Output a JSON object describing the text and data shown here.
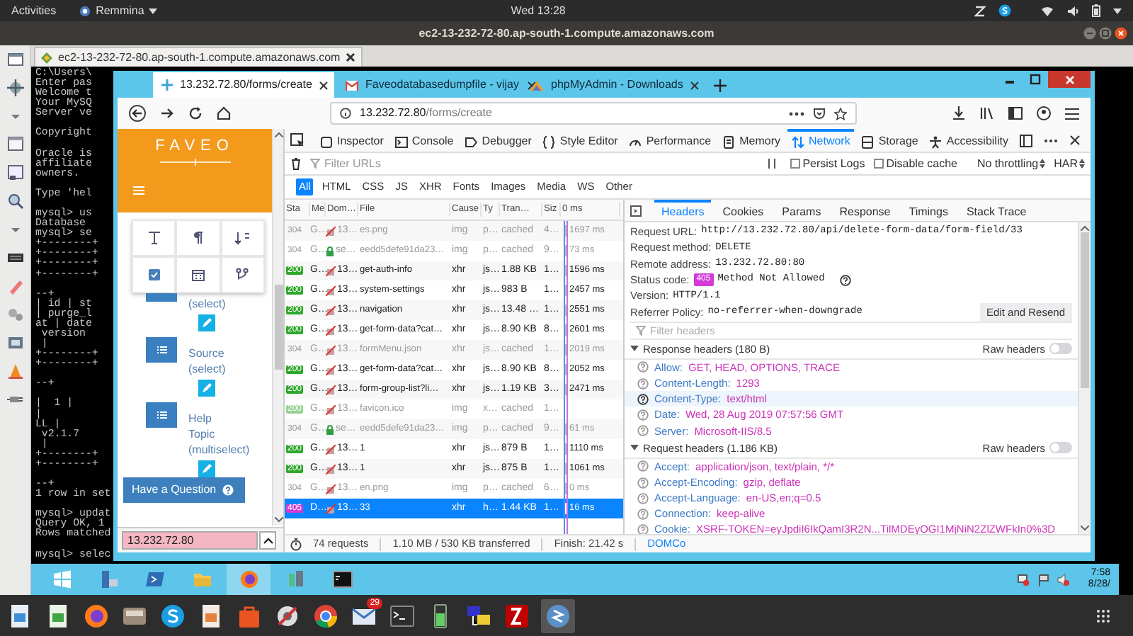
{
  "top_bar": {
    "activities": "Activities",
    "app_menu": "Remmina",
    "clock": "Wed 13:28"
  },
  "remmina": {
    "title": "ec2-13-232-72-80.ap-south-1.compute.amazonaws.com",
    "tab": "ec2-13-232-72-80.ap-south-1.compute.amazonaws.com"
  },
  "terminal": {
    "blocks": [
      [
        "C:\\Users\\",
        "Enter pas",
        "Welcome t",
        "Your MySQ",
        "Server ve"
      ],
      [
        "Copyright"
      ],
      [
        "Oracle is",
        "affiliate",
        "owners."
      ],
      [
        "Type 'hel"
      ],
      [
        "mysql> us",
        "Database",
        "mysql> se",
        "+--------+",
        "+--------+",
        "+--------+",
        "+--------+"
      ],
      [
        "--+",
        "| id | st",
        "| purge_l",
        "at | date",
        " version",
        " |",
        "+--------+",
        "+--------+"
      ],
      [
        "--+"
      ],
      [
        "|  1 |",
        "|",
        "LL |",
        " v2.1.7",
        " |",
        "+--------+",
        "+--------+"
      ],
      [
        "--+",
        "1 row in set"
      ],
      [
        "mysql> updat",
        "Query OK, 1",
        "Rows matched"
      ],
      [
        "mysql> selec"
      ]
    ]
  },
  "firefox": {
    "tabs": [
      {
        "label": "13.232.72.80/forms/create",
        "selected": true
      },
      {
        "label": "Faveodatabasedumpfile - vijay",
        "selected": false
      },
      {
        "label": "phpMyAdmin - Downloads",
        "selected": false
      }
    ],
    "url": {
      "host": "13.232.72.80",
      "path": "/forms/create"
    }
  },
  "page": {
    "logo": "FAVEO",
    "fields": [
      {
        "lines": [
          "(select)"
        ]
      },
      {
        "lines": [
          "Source",
          "(select)"
        ]
      },
      {
        "lines": [
          "Help",
          "Topic",
          "(multiselect)"
        ]
      }
    ],
    "help_button": "Have a Question",
    "find_value": "13.232.72.80"
  },
  "devtools": {
    "tools": [
      {
        "label": "Inspector",
        "selected": false
      },
      {
        "label": "Console",
        "selected": false
      },
      {
        "label": "Debugger",
        "selected": false
      },
      {
        "label": "Style Editor",
        "selected": false
      },
      {
        "label": "Performance",
        "selected": false
      },
      {
        "label": "Memory",
        "selected": false
      },
      {
        "label": "Network",
        "selected": true
      },
      {
        "label": "Storage",
        "selected": false
      },
      {
        "label": "Accessibility",
        "selected": false
      }
    ],
    "filter_placeholder": "Filter URLs",
    "options": [
      {
        "label": "Persist Logs",
        "checked": false
      },
      {
        "label": "Disable cache",
        "checked": false
      }
    ],
    "throttling": "No throttling",
    "har": "HAR",
    "types": [
      {
        "label": "All",
        "selected": true
      },
      {
        "label": "HTML",
        "selected": false
      },
      {
        "label": "CSS",
        "selected": false
      },
      {
        "label": "JS",
        "selected": false
      },
      {
        "label": "XHR",
        "selected": false
      },
      {
        "label": "Fonts",
        "selected": false
      },
      {
        "label": "Images",
        "selected": false
      },
      {
        "label": "Media",
        "selected": false
      },
      {
        "label": "WS",
        "selected": false
      },
      {
        "label": "Other",
        "selected": false
      }
    ],
    "columns": [
      "Sta",
      "Me",
      "Dom…",
      "File",
      "Cause",
      "Ty",
      "Tran…",
      "Siz",
      "0 ms"
    ],
    "rows": [
      {
        "status": "304",
        "kind": "cached",
        "method": "G…",
        "secure": false,
        "domain": "13…",
        "file": "es.png",
        "cause": "img",
        "type": "p…",
        "transferred": "cached",
        "size": "4…",
        "time": "1697 ms",
        "muted": true,
        "selected": false
      },
      {
        "status": "304",
        "kind": "cached",
        "method": "G…",
        "secure": true,
        "domain": "se…",
        "file": "eedd5defe91da23…",
        "cause": "img",
        "type": "p…",
        "transferred": "cached",
        "size": "9…",
        "time": "73 ms",
        "muted": true,
        "selected": false
      },
      {
        "status": "200",
        "kind": "ok",
        "method": "G…",
        "secure": false,
        "domain": "13…",
        "file": "get-auth-info",
        "cause": "xhr",
        "type": "js…",
        "transferred": "1.88 KB",
        "size": "1…",
        "time": "1596 ms",
        "muted": false,
        "selected": false
      },
      {
        "status": "200",
        "kind": "ok",
        "method": "G…",
        "secure": false,
        "domain": "13…",
        "file": "system-settings",
        "cause": "xhr",
        "type": "js…",
        "transferred": "983 B",
        "size": "1…",
        "time": "2457 ms",
        "muted": false,
        "selected": false
      },
      {
        "status": "200",
        "kind": "ok",
        "method": "G…",
        "secure": false,
        "domain": "13…",
        "file": "navigation",
        "cause": "xhr",
        "type": "js…",
        "transferred": "13.48 …",
        "size": "1…",
        "time": "2551 ms",
        "muted": false,
        "selected": false
      },
      {
        "status": "200",
        "kind": "ok",
        "method": "G…",
        "secure": false,
        "domain": "13…",
        "file": "get-form-data?cat…",
        "cause": "xhr",
        "type": "js…",
        "transferred": "8.90 KB",
        "size": "8…",
        "time": "2601 ms",
        "muted": false,
        "selected": false
      },
      {
        "status": "304",
        "kind": "cached",
        "method": "G…",
        "secure": false,
        "domain": "13…",
        "file": "formMenu.json",
        "cause": "xhr",
        "type": "js…",
        "transferred": "cached",
        "size": "1…",
        "time": "2019 ms",
        "muted": true,
        "selected": false
      },
      {
        "status": "200",
        "kind": "ok",
        "method": "G…",
        "secure": false,
        "domain": "13…",
        "file": "get-form-data?cat…",
        "cause": "xhr",
        "type": "js…",
        "transferred": "8.90 KB",
        "size": "8…",
        "time": "2052 ms",
        "muted": false,
        "selected": false
      },
      {
        "status": "200",
        "kind": "ok",
        "method": "G…",
        "secure": false,
        "domain": "13…",
        "file": "form-group-list?li…",
        "cause": "xhr",
        "type": "js…",
        "transferred": "1.19 KB",
        "size": "3…",
        "time": "2471 ms",
        "muted": false,
        "selected": false
      },
      {
        "status": "200",
        "kind": "ok",
        "method": "G…",
        "secure": false,
        "domain": "13…",
        "file": "favicon.ico",
        "cause": "img",
        "type": "x…",
        "transferred": "cached",
        "size": "1…",
        "muted": true,
        "selected": false
      },
      {
        "status": "304",
        "kind": "cached",
        "method": "G…",
        "secure": true,
        "domain": "se…",
        "file": "eedd5defe91da23…",
        "cause": "img",
        "type": "p…",
        "transferred": "cached",
        "size": "9…",
        "time": "61 ms",
        "muted": true,
        "selected": false
      },
      {
        "status": "200",
        "kind": "ok",
        "method": "G…",
        "secure": false,
        "domain": "13…",
        "file": "1",
        "cause": "xhr",
        "type": "js…",
        "transferred": "879 B",
        "size": "1…",
        "time": "1110 ms",
        "muted": false,
        "selected": false
      },
      {
        "status": "200",
        "kind": "ok",
        "method": "G…",
        "secure": false,
        "domain": "13…",
        "file": "1",
        "cause": "xhr",
        "type": "js…",
        "transferred": "875 B",
        "size": "1…",
        "time": "1061 ms",
        "muted": false,
        "selected": false
      },
      {
        "status": "304",
        "kind": "cached",
        "method": "G…",
        "secure": false,
        "domain": "13…",
        "file": "en.png",
        "cause": "img",
        "type": "p…",
        "transferred": "cached",
        "size": "6…",
        "time": "0 ms",
        "muted": true,
        "selected": false
      },
      {
        "status": "405",
        "kind": "error",
        "method": "D…",
        "secure": false,
        "domain": "13…",
        "file": "33",
        "cause": "xhr",
        "type": "h…",
        "transferred": "1.44 KB",
        "size": "1…",
        "time": "16 ms",
        "muted": false,
        "selected": true
      }
    ],
    "summary": {
      "requests": "74 requests",
      "transferred": "1.10 MB / 530 KB transferred",
      "finish": "Finish: 21.42 s",
      "dom": "DOMCo"
    },
    "detail_tabs": [
      {
        "label": "Headers",
        "selected": true
      },
      {
        "label": "Cookies",
        "selected": false
      },
      {
        "label": "Params",
        "selected": false
      },
      {
        "label": "Response",
        "selected": false
      },
      {
        "label": "Timings",
        "selected": false
      },
      {
        "label": "Stack Trace",
        "selected": false
      }
    ],
    "general": [
      {
        "label": "Request URL:",
        "value": "http://13.232.72.80/api/delete-form-data/form-field/33"
      },
      {
        "label": "Request method:",
        "value": "DELETE"
      },
      {
        "label": "Remote address:",
        "value": "13.232.72.80:80"
      },
      {
        "label": "Status code:",
        "badge": "405",
        "value": "Method Not Allowed"
      },
      {
        "label": "Version:",
        "value": "HTTP/1.1"
      },
      {
        "label": "Referrer Policy:",
        "value": "no-referrer-when-downgrade"
      }
    ],
    "resend_button": "Edit and Resend",
    "filter_headers_placeholder": "Filter headers",
    "sections": [
      {
        "title": "Response headers (180 B)",
        "expanded": true,
        "raw": {
          "label": "Raw headers",
          "on": false
        },
        "headers": [
          {
            "name": "Allow:",
            "value": "GET, HEAD, OPTIONS, TRACE",
            "selected": false
          },
          {
            "name": "Content-Length:",
            "value": "1293",
            "selected": false
          },
          {
            "name": "Content-Type:",
            "value": "text/html",
            "selected": true
          },
          {
            "name": "Date:",
            "value": "Wed, 28 Aug 2019 07:57:56 GMT",
            "selected": false
          },
          {
            "name": "Server:",
            "value": "Microsoft-IIS/8.5",
            "selected": false
          }
        ]
      },
      {
        "title": "Request headers (1.186 KB)",
        "expanded": true,
        "raw": {
          "label": "Raw headers",
          "on": false
        },
        "headers": [
          {
            "name": "Accept:",
            "value": "application/json, text/plain, */*",
            "selected": false
          },
          {
            "name": "Accept-Encoding:",
            "value": "gzip, deflate",
            "selected": false
          },
          {
            "name": "Accept-Language:",
            "value": "en-US,en;q=0.5",
            "selected": false
          },
          {
            "name": "Connection:",
            "value": "keep-alive",
            "selected": false
          },
          {
            "name": "Cookie:",
            "value": "XSRF-TOKEN=eyJpdiI6IkQamI3R2N...TilMDEyOGI1MjNiN2ZlZWFkIn0%3D",
            "selected": false
          }
        ]
      }
    ]
  },
  "windows_taskbar": {
    "time": "7:58",
    "date": "8/28/"
  },
  "dock": {
    "mail_badge": "29"
  }
}
